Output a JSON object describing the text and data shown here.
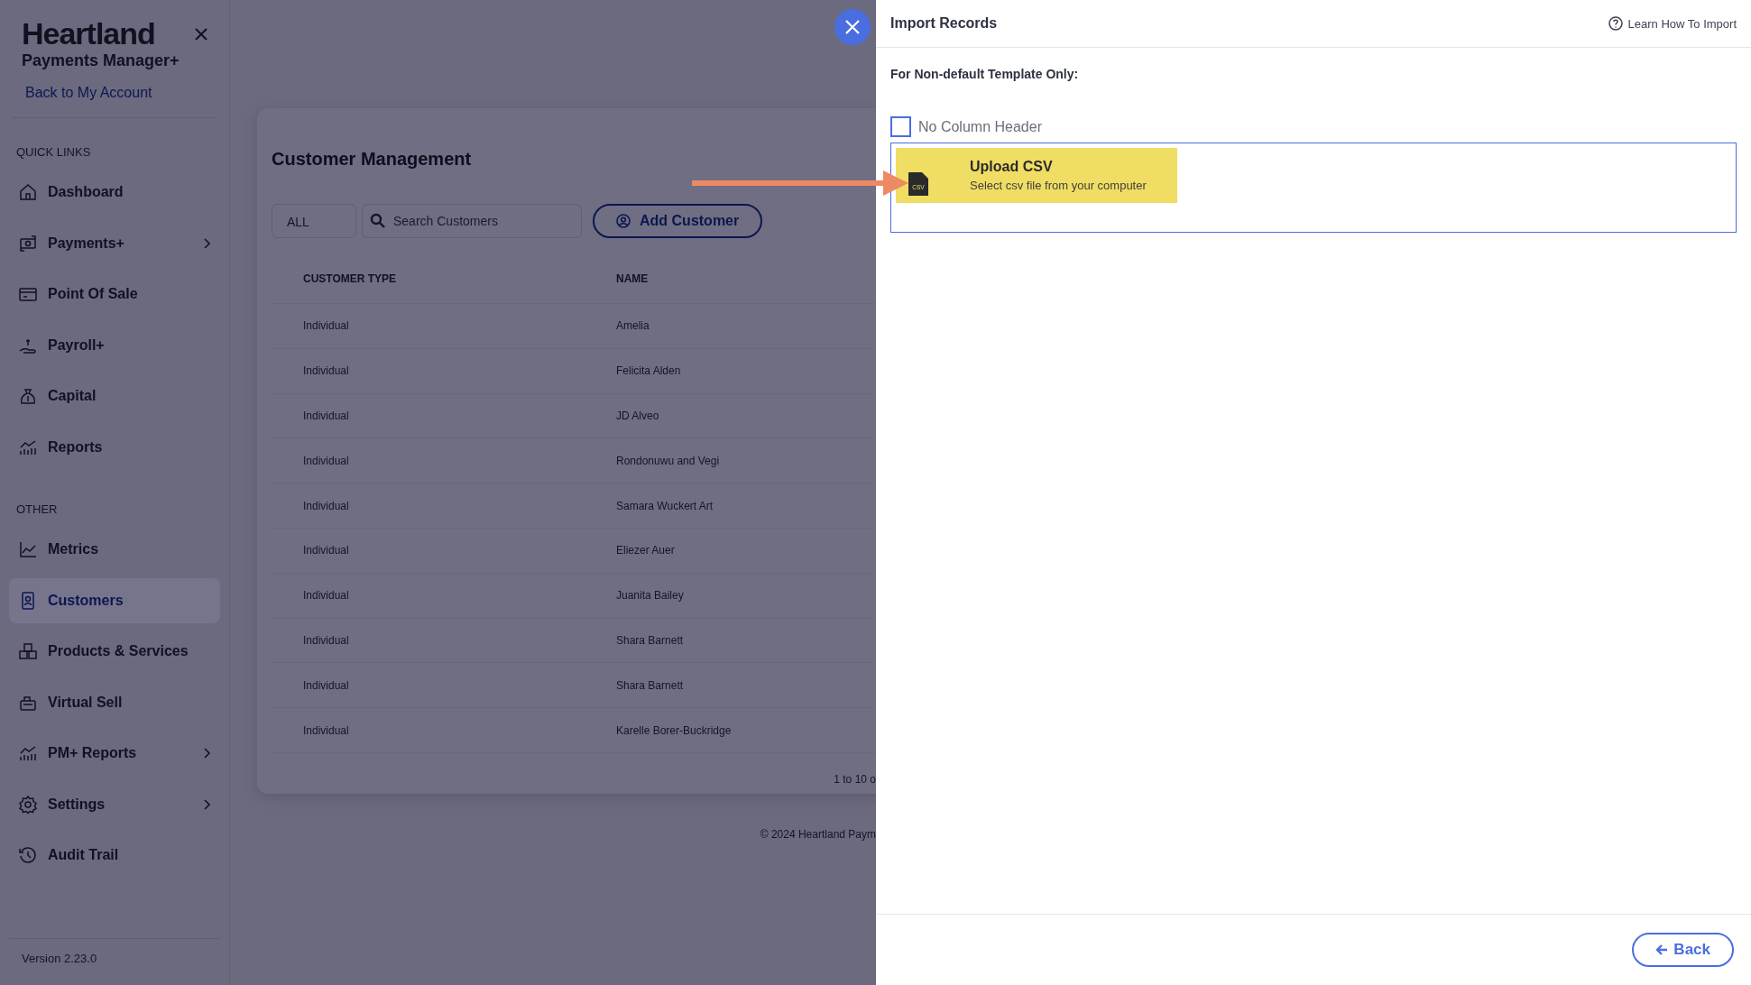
{
  "sidebar": {
    "logo": "Heartland",
    "product": "Payments Manager+",
    "back_link": "Back to My Account",
    "sections": [
      {
        "label": "QUICK LINKS",
        "items": [
          {
            "label": "Dashboard",
            "selected": false,
            "expandable": false
          },
          {
            "label": "Payments+",
            "selected": false,
            "expandable": true
          },
          {
            "label": "Point Of Sale",
            "selected": false,
            "expandable": false
          },
          {
            "label": "Payroll+",
            "selected": false,
            "expandable": false
          },
          {
            "label": "Capital",
            "selected": false,
            "expandable": false
          },
          {
            "label": "Reports",
            "selected": false,
            "expandable": false
          }
        ]
      },
      {
        "label": "OTHER",
        "items": [
          {
            "label": "Metrics",
            "selected": false,
            "expandable": false
          },
          {
            "label": "Customers",
            "selected": true,
            "expandable": false
          },
          {
            "label": "Products & Services",
            "selected": false,
            "expandable": false
          },
          {
            "label": "Virtual Sell",
            "selected": false,
            "expandable": false
          },
          {
            "label": "PM+ Reports",
            "selected": false,
            "expandable": true
          },
          {
            "label": "Settings",
            "selected": false,
            "expandable": true
          },
          {
            "label": "Audit Trail",
            "selected": false,
            "expandable": false
          }
        ]
      }
    ],
    "version": "Version 2.23.0"
  },
  "main": {
    "title": "Customer Management",
    "filter": "ALL",
    "search": {
      "placeholder": "Search Customers"
    },
    "add_button": "Add Customer",
    "table": {
      "columns": [
        "CUSTOMER TYPE",
        "NAME"
      ],
      "rows": [
        [
          "Individual",
          "Amelia"
        ],
        [
          "Individual",
          "Felicita Alden"
        ],
        [
          "Individual",
          "JD Alveo"
        ],
        [
          "Individual",
          "Rondonuwu and Vegi"
        ],
        [
          "Individual",
          "Samara Wuckert Art"
        ],
        [
          "Individual",
          "Eliezer Auer"
        ],
        [
          "Individual",
          "Juanita Bailey"
        ],
        [
          "Individual",
          "Shara Barnett"
        ],
        [
          "Individual",
          "Shara Barnett"
        ],
        [
          "Individual",
          "Karelle Borer-Buckridge"
        ]
      ]
    },
    "pagination": "1 to 10 o",
    "footer": "© 2024 Heartland Paym"
  },
  "dialog": {
    "title": "Import Records",
    "help_link": "Learn How To Import",
    "section_label": "For Non-default Template Only:",
    "no_column_header": {
      "label": "No Column Header",
      "checked": false
    },
    "upload": {
      "title": "Upload CSV",
      "subtitle": "Select csv file from your computer",
      "icon_text": "CSV"
    },
    "back_button": "Back"
  }
}
